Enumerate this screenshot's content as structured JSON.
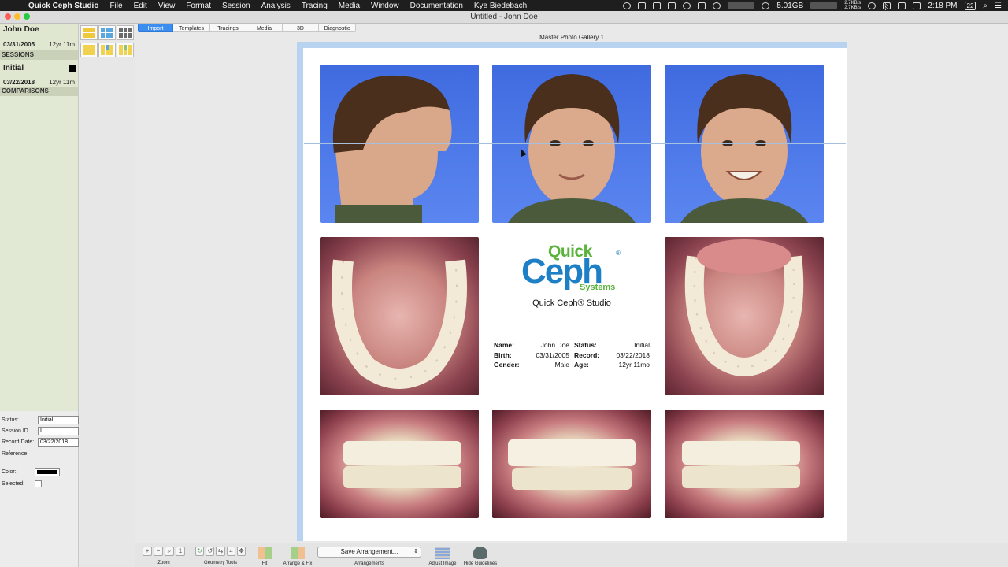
{
  "menubar": {
    "app_name": "Quick Ceph Studio",
    "menus": [
      "File",
      "Edit",
      "View",
      "Format",
      "Session",
      "Analysis",
      "Tracing",
      "Media",
      "Window",
      "Documentation",
      "Kye Biedebach"
    ],
    "net_up": "2.7KB/s",
    "net_down": "2.7KB/s",
    "battery_label": "5.01GB",
    "time": "2:18 PM",
    "calendar_badge": "22"
  },
  "window": {
    "title": "Untitled - John Doe"
  },
  "patient": {
    "name": "John Doe",
    "birth_date": "03/31/2005",
    "age": "12yr 11m"
  },
  "sessions_header": "SESSIONS",
  "session": {
    "name": "Initial",
    "date": "03/22/2018",
    "age": "12yr 11m",
    "color": "#000000"
  },
  "comparisons_header": "COMPARISONS",
  "props": {
    "status_label": "Status:",
    "status_value": "Initial",
    "session_id_label": "Session ID",
    "session_id_value": "I",
    "record_date_label": "Record Date:",
    "record_date_value": "03/22/2018",
    "reference_label": "Reference",
    "color_label": "Color:",
    "selected_label": "Selected:"
  },
  "tabs": [
    "Import",
    "Templates",
    "Tracings",
    "Media",
    "3D",
    "Diagnostic"
  ],
  "active_tab": "Import",
  "gallery": {
    "title": "Master Photo Gallery 1"
  },
  "photos": {
    "row1": [
      "profile-photo",
      "frontal-photo",
      "smile-photo"
    ],
    "row2": [
      "upper-occlusal-photo",
      "lower-occlusal-photo"
    ],
    "row3": [
      "right-buccal-photo",
      "anterior-photo",
      "left-buccal-photo"
    ]
  },
  "logo": {
    "quick": "Quick",
    "ceph": "Ceph",
    "reg": "®",
    "systems": "Systems",
    "studio": "Quick Ceph® Studio"
  },
  "info": {
    "name_label": "Name:",
    "name_value": "John Doe",
    "status_label": "Status:",
    "status_value": "Initial",
    "birth_label": "Birth:",
    "birth_value": "03/31/2005",
    "record_label": "Record:",
    "record_value": "03/22/2018",
    "gender_label": "Gender:",
    "gender_value": "Male",
    "age_label": "Age:",
    "age_value": "12yr 11mo"
  },
  "toolbar": {
    "zoom": "Zoom",
    "geometry": "Geometry Tools",
    "fit": "Fit",
    "arrange_fit": "Arrange & Fix",
    "arrangements": "Arrangements",
    "save_arrangement": "Save Arrangement...",
    "adjust_image": "Adjust Image",
    "hide_guidelines": "Hide Guidelines"
  },
  "colors": {
    "accent": "#3b8ef0",
    "panel_green": "#dfe7d0",
    "canvas_border": "#b7d3ef",
    "photo_bg": "#4a74e8"
  }
}
